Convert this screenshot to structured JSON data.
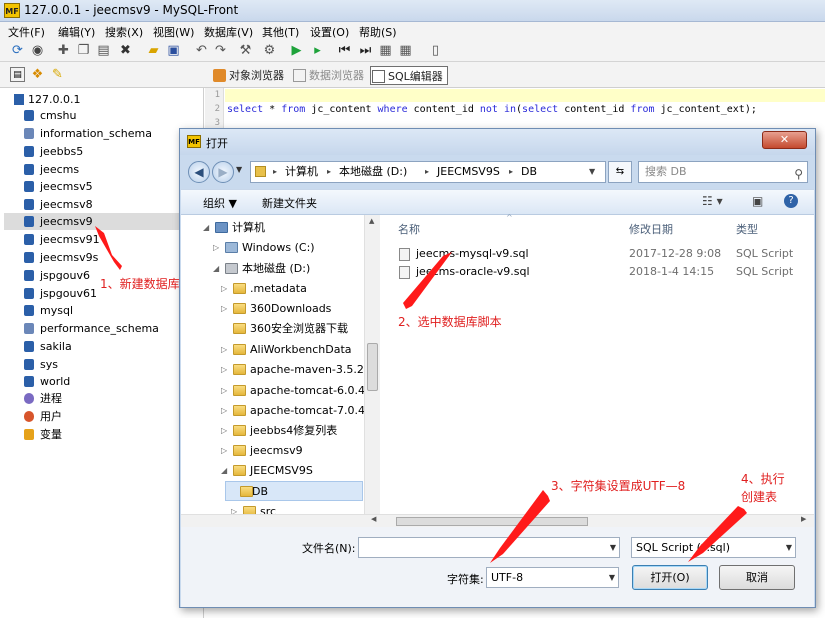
{
  "window": {
    "title": "127.0.0.1 - jeecmsv9 - MySQL-Front",
    "logo_text": "MF"
  },
  "menu": [
    "文件(F)",
    "编辑(Y)",
    "搜索(X)",
    "视图(W)",
    "数据库(V)",
    "其他(T)",
    "设置(O)",
    "帮助(S)"
  ],
  "toolbar_icons": [
    "refresh-icon",
    "stop-icon",
    "add-icon",
    "copy-icon",
    "paste-icon",
    "delete-icon",
    "folder-icon",
    "save-icon",
    "undo-icon",
    "redo-icon",
    "wrench-icon",
    "tool-icon",
    "run-icon",
    "run-step-icon",
    "first-icon",
    "last-icon",
    "grid-icon",
    "grid-icon",
    "doc-icon"
  ],
  "tabs": {
    "object_browser": "对象浏览器",
    "data_browser": "数据浏览器",
    "sql_editor": "SQL编辑器"
  },
  "tree": {
    "server": "127.0.0.1",
    "databases": [
      "cmshu",
      "information_schema",
      "jeebbs5",
      "jeecms",
      "jeecmsv5",
      "jeecmsv8",
      "jeecmsv9",
      "jeecmsv91",
      "jeecmsv9s",
      "jspgouv6",
      "jspgouv61",
      "mysql",
      "performance_schema",
      "sakila",
      "sys",
      "world"
    ],
    "selected": "jeecmsv9",
    "extras": [
      "进程",
      "用户",
      "变量"
    ]
  },
  "editor": {
    "line_numbers": [
      "1",
      "2",
      "3"
    ],
    "code": {
      "kw_select": "select",
      "star": " * ",
      "kw_from": "from",
      "t1": " jc_content ",
      "kw_where": "where",
      "col": " content_id ",
      "kw_notin": "not in",
      "p_open": "(",
      "kw_select2": "select",
      "col2": " content_id ",
      "kw_from2": "from",
      "t2": " jc_content_ext);"
    }
  },
  "dialog": {
    "title": "打开",
    "close_glyph": "✕",
    "breadcrumb": [
      "计算机",
      "本地磁盘 (D:)",
      "JEECMSV9S",
      "DB"
    ],
    "search_placeholder": "搜索 DB",
    "organize": "组织 ▼",
    "new_folder": "新建文件夹",
    "nav_items": [
      {
        "label": "计算机"
      },
      {
        "label": "Windows (C:)"
      },
      {
        "label": "本地磁盘 (D:)"
      },
      {
        "label": ".metadata"
      },
      {
        "label": "360Downloads"
      },
      {
        "label": "360安全浏览器下载"
      },
      {
        "label": "AliWorkbenchData"
      },
      {
        "label": "apache-maven-3.5.2"
      },
      {
        "label": "apache-tomcat-6.0.41"
      },
      {
        "label": "apache-tomcat-7.0.47"
      },
      {
        "label": "jeebbs4修复列表"
      },
      {
        "label": "jeecmsv9"
      },
      {
        "label": "JEECMSV9S"
      },
      {
        "label": "DB"
      },
      {
        "label": "src"
      }
    ],
    "columns": {
      "name": "名称",
      "modified": "修改日期",
      "type": "类型"
    },
    "files": [
      {
        "name": "jeecms-mysql-v9.sql",
        "date": "2017-12-28 9:08",
        "type": "SQL Script"
      },
      {
        "name": "jeecms-oracle-v9.sql",
        "date": "2018-1-4 14:15",
        "type": "SQL Script"
      }
    ],
    "filename_label": "文件名(N):",
    "filename_value": "",
    "filetype_value": "SQL Script (*.sql)",
    "charset_label": "字符集:",
    "charset_value": "UTF-8",
    "open_button": "打开(O)",
    "cancel_button": "取消"
  },
  "annotations": {
    "step1": "1、新建数据库",
    "step2": "2、选中数据库脚本",
    "step3": "3、字符集设置成UTF—8",
    "step4_line1": "4、执行",
    "step4_line2": "创建表"
  }
}
